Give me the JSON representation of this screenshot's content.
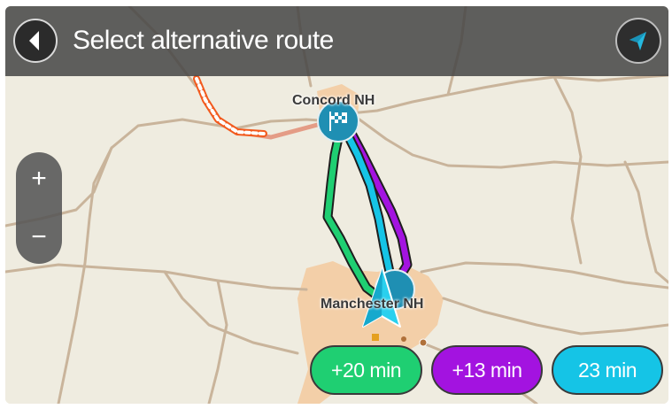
{
  "header": {
    "title": "Select alternative route",
    "back_icon": "chevron-left-icon",
    "nav_icon": "navigation-arrow-icon"
  },
  "zoom": {
    "in_label": "+",
    "out_label": "−"
  },
  "map": {
    "places": [
      "Concord NH",
      "Manchester NH"
    ],
    "destination_icon": "checkered-flag-icon",
    "current_position_icon": "position-arrow-icon"
  },
  "routes": [
    {
      "label": "+20 min",
      "color": "#1fcf72"
    },
    {
      "label": "+13 min",
      "color": "#a313e0"
    },
    {
      "label": "23 min",
      "color": "#15c4e6"
    }
  ],
  "colors": {
    "map_bg": "#efece0",
    "road": "#c9b49b",
    "urban": "#f3cfa8",
    "route_green": "#1fcf72",
    "route_purple": "#a313e0",
    "route_blue": "#15c4e6",
    "marker": "#1f8fb3"
  }
}
